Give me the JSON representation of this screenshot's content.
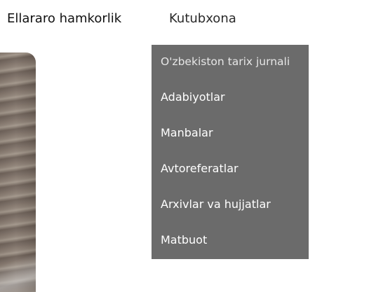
{
  "nav": {
    "items": [
      {
        "label": "Ellararo hamkorlik"
      },
      {
        "label": "Kutubxona"
      }
    ]
  },
  "library_menu": {
    "items": [
      {
        "label": "O'zbekiston tarix jurnali"
      },
      {
        "label": "Adabiyotlar"
      },
      {
        "label": "Manbalar"
      },
      {
        "label": "Avtoreferatlar"
      },
      {
        "label": "Arxivlar va hujjatlar"
      },
      {
        "label": "Matbuot"
      }
    ]
  },
  "colors": {
    "dropdown_bg": "#6b6b6b",
    "nav_text": "#111111",
    "menu_text": "#ffffff"
  }
}
